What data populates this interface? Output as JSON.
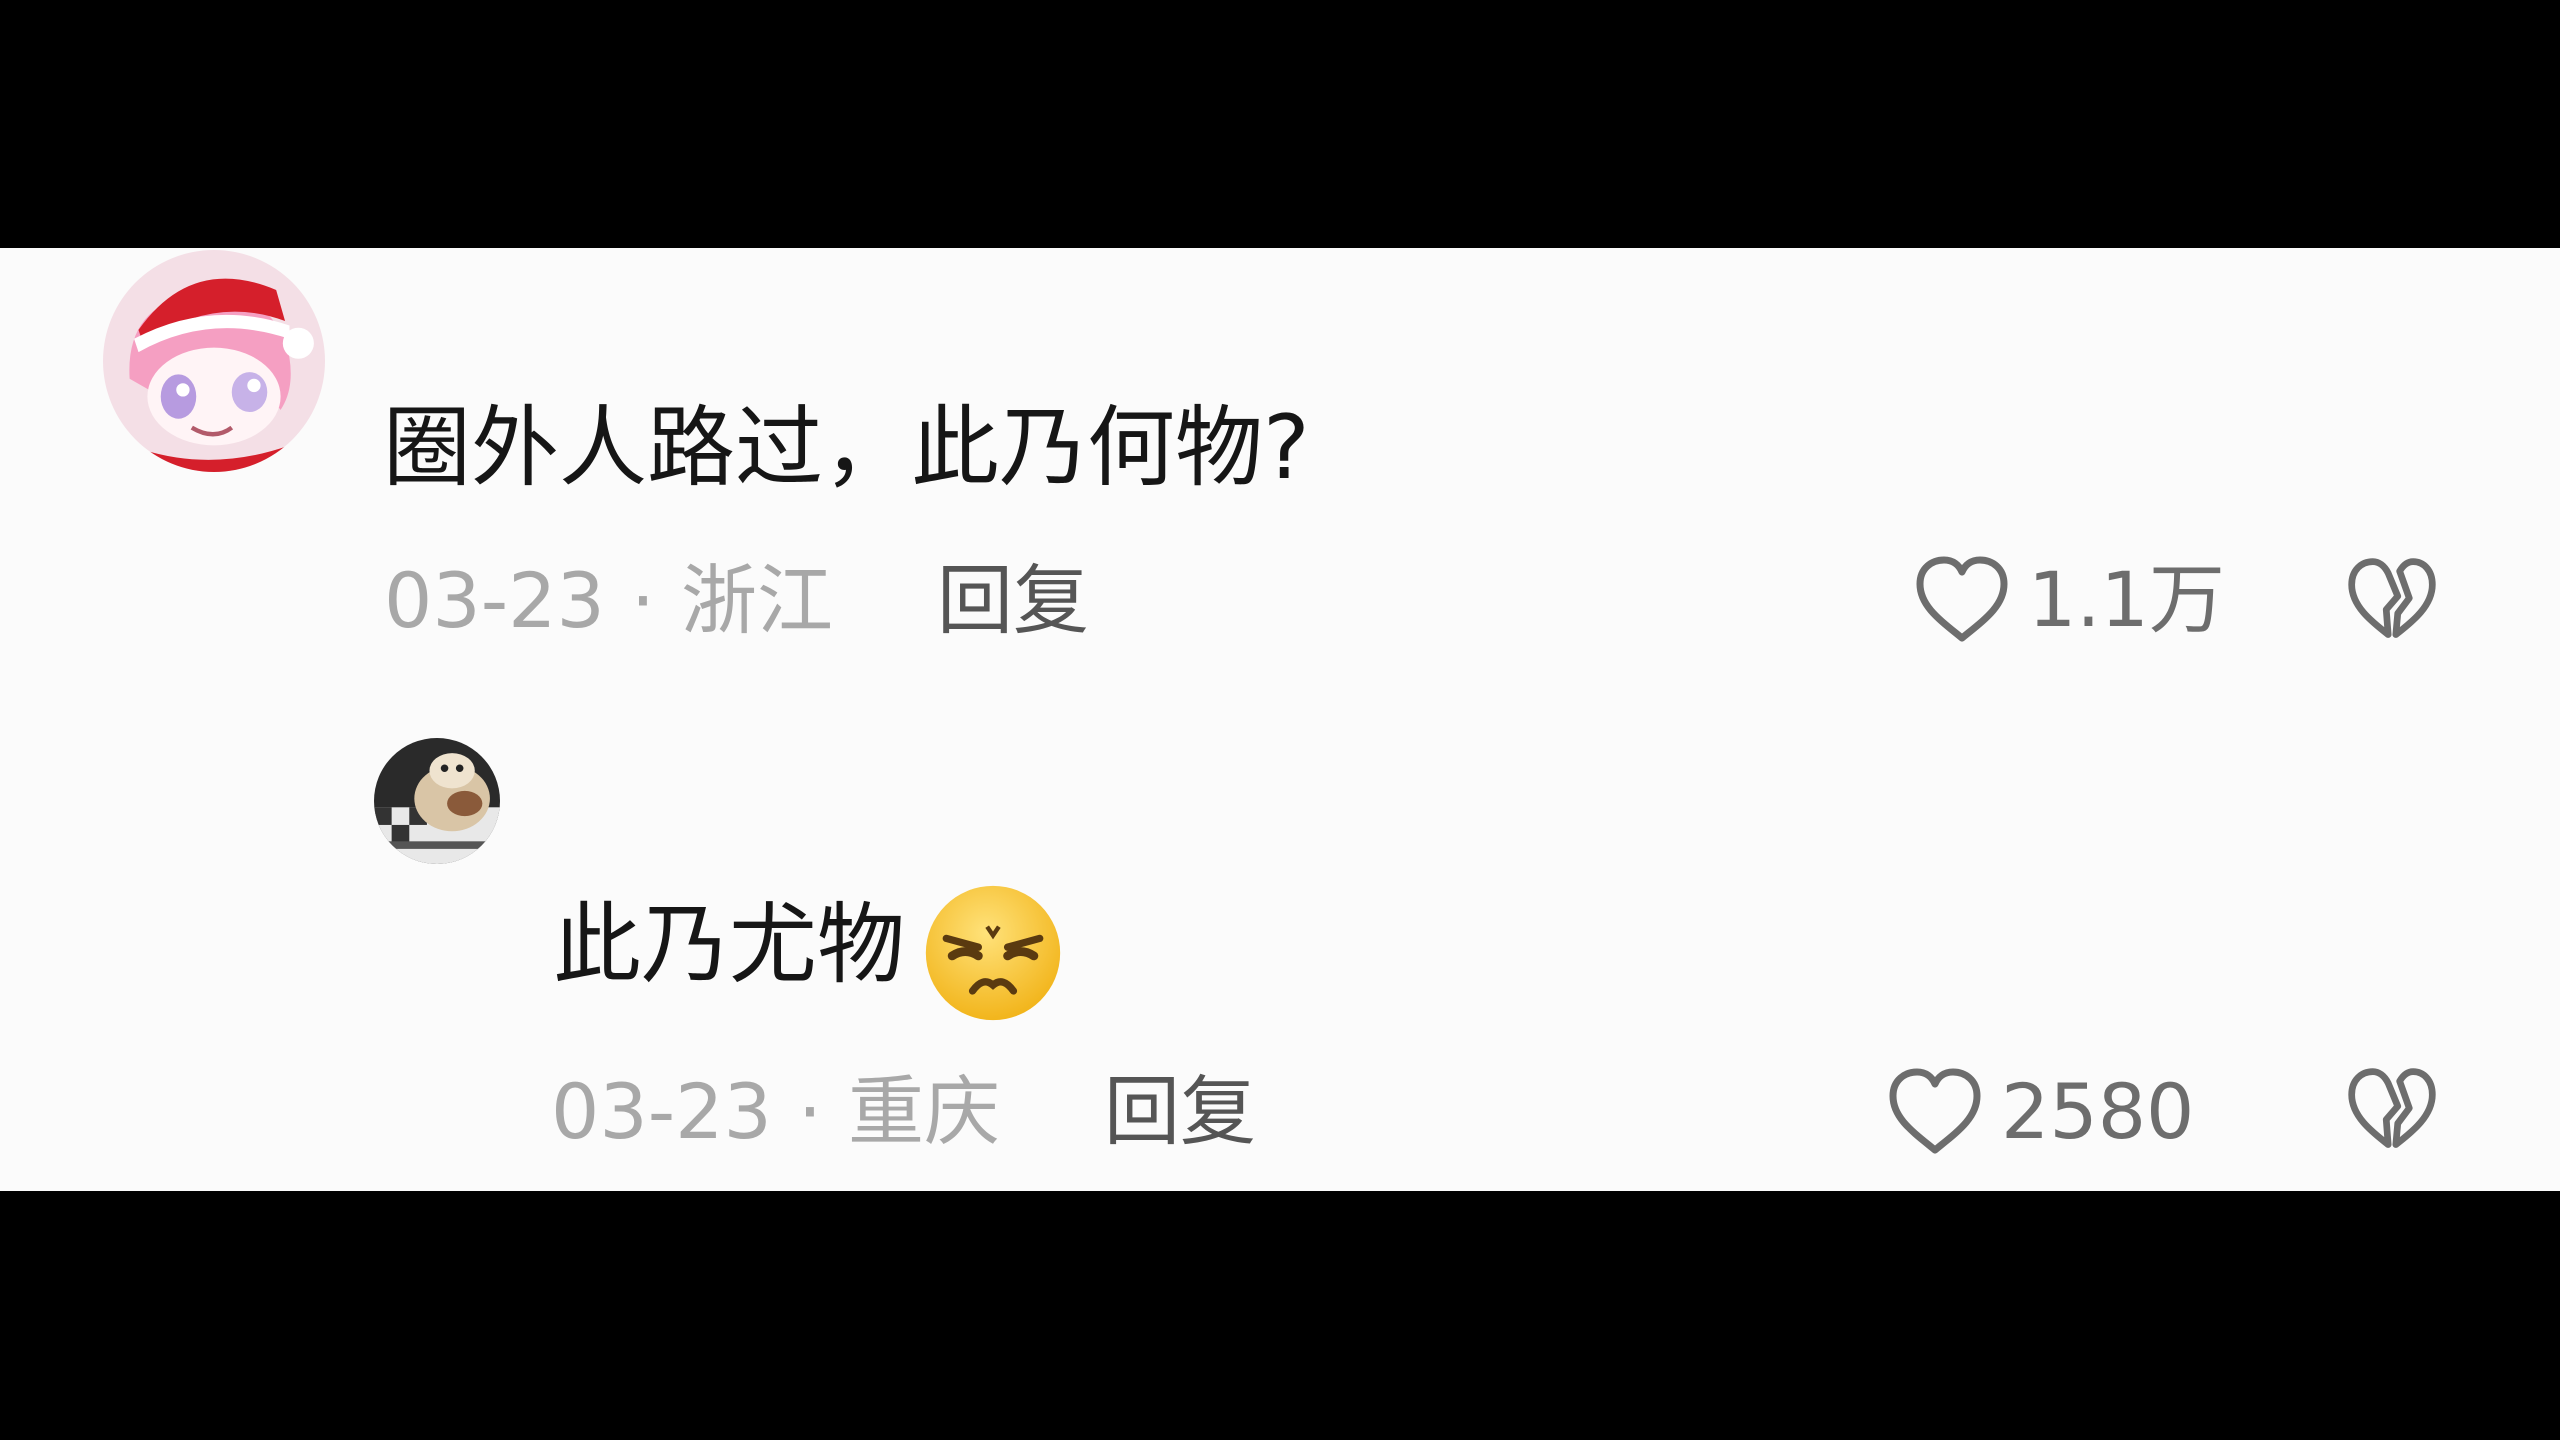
{
  "comments": [
    {
      "avatar": "pink-hair-santa-hat-avatar",
      "text": "圈外人路过，此乃何物?",
      "date": "03-23",
      "separator": "·",
      "location": "浙江",
      "reply_label": "回复",
      "likes": "1.1万",
      "like_icon": "heart-outline-icon",
      "dislike_icon": "broken-heart-icon"
    },
    {
      "avatar": "cat-photo-avatar",
      "text": "此乃尤物",
      "emoji": "disgruntled-face-emoji",
      "date": "03-23",
      "separator": "·",
      "location": "重庆",
      "reply_label": "回复",
      "likes": "2580",
      "like_icon": "heart-outline-icon",
      "dislike_icon": "broken-heart-icon"
    }
  ],
  "colors": {
    "background": "#fbfbfb",
    "letterbox": "#000000",
    "text": "#161616",
    "meta": "#a8a8a8",
    "reply": "#555555",
    "icon": "#6d6d6d",
    "emoji": "#f7c531"
  }
}
